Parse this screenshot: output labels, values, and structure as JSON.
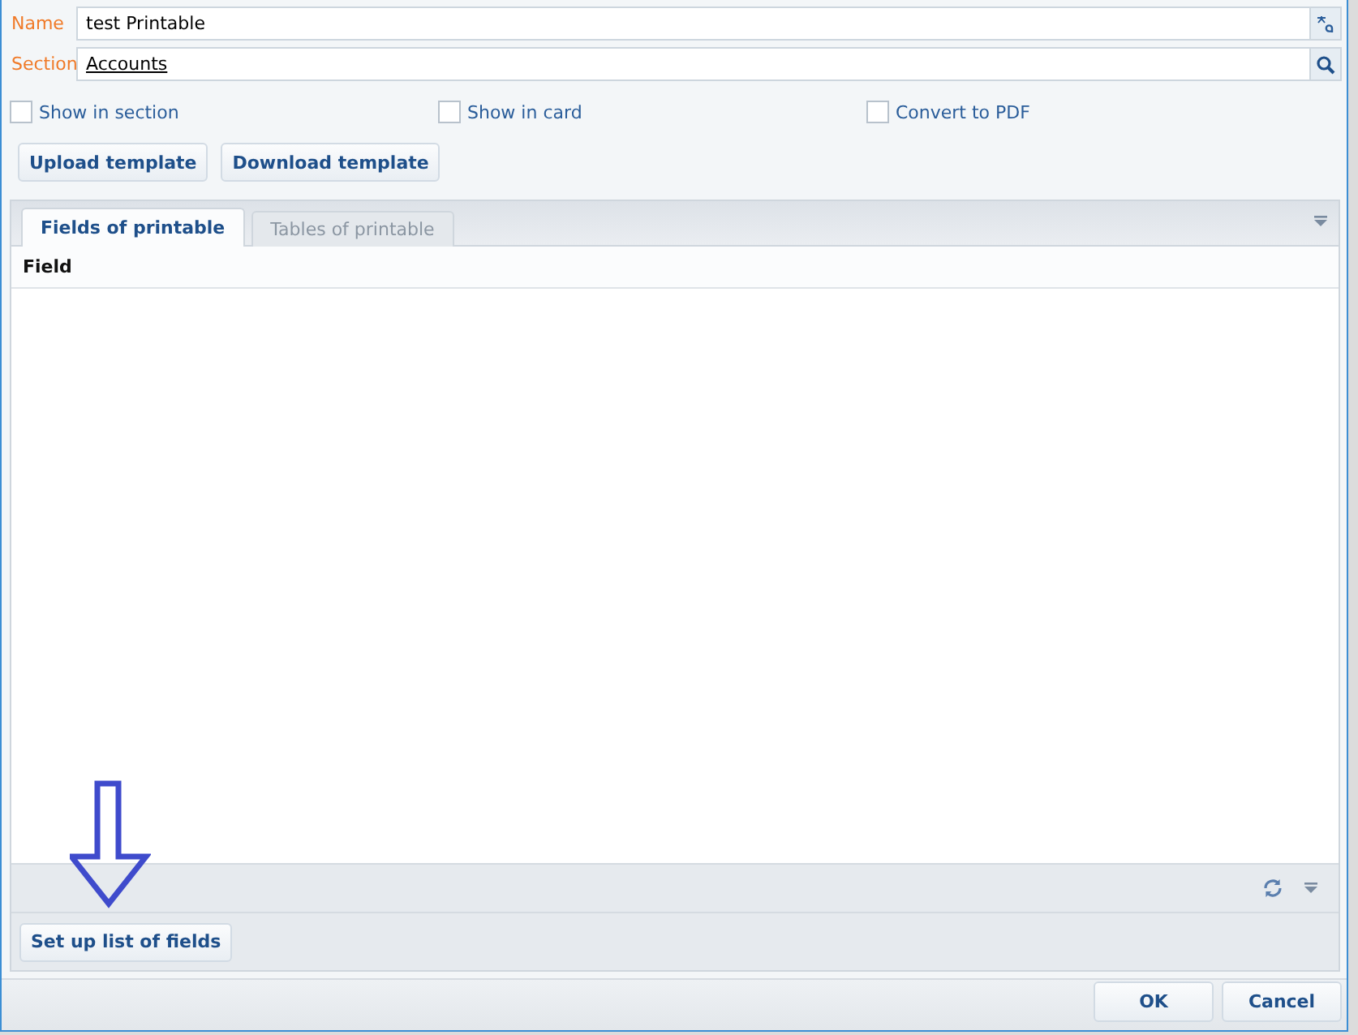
{
  "fields": [
    {
      "label": "Name",
      "value": "test Printable",
      "kind": "text"
    },
    {
      "label": "Section",
      "value": "Accounts",
      "kind": "lookup"
    }
  ],
  "checkboxes": [
    {
      "label": "Show in section",
      "checked": false
    },
    {
      "label": "Show in card",
      "checked": false
    },
    {
      "label": "Convert to PDF",
      "checked": false
    }
  ],
  "template_buttons": [
    "Upload template",
    "Download template"
  ],
  "tabs": [
    {
      "label": "Fields of printable",
      "selected": true
    },
    {
      "label": "Tables of printable",
      "selected": false
    }
  ],
  "table": {
    "columns": [
      "Field"
    ]
  },
  "setup_button": "Set up list of fields",
  "dialog_buttons": [
    "OK",
    "Cancel"
  ]
}
